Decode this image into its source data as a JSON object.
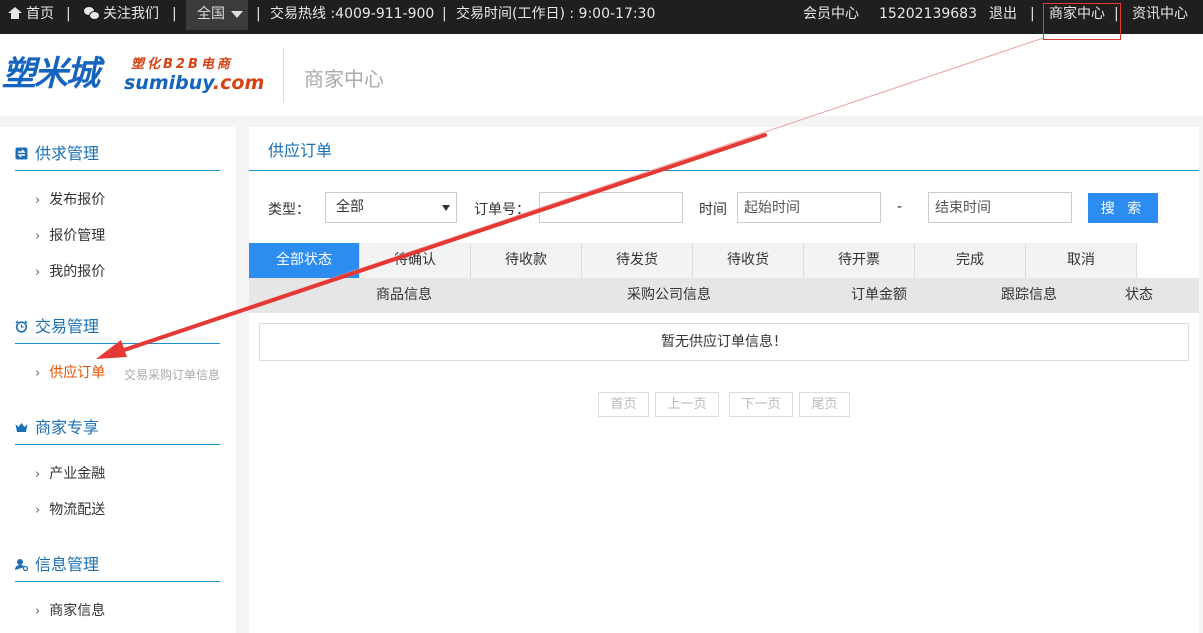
{
  "topbar": {
    "home": "首页",
    "follow": "关注我们",
    "region": "全国",
    "hotline": "交易热线 :4009-911-900",
    "hours": "交易时间(工作日) : 9:00-17:30",
    "member_center": "会员中心",
    "phone": "15202139683",
    "logout": "退出",
    "merchant_center": "商家中心",
    "news_center": "资讯中心",
    "divider": "|"
  },
  "header": {
    "logo_cn": "塑米城",
    "logo_tagline": "塑化B2B电商",
    "logo_en": "sumibuy",
    "logo_en_suffix": ".com",
    "title": "商家中心"
  },
  "sidebar": {
    "sections": [
      {
        "title": "供求管理",
        "icon": "swap-icon",
        "items": [
          "发布报价",
          "报价管理",
          "我的报价"
        ]
      },
      {
        "title": "交易管理",
        "icon": "alarm-icon",
        "items": [
          "供应订单"
        ]
      },
      {
        "title": "商家专享",
        "icon": "crown-icon",
        "items": [
          "产业金融",
          "物流配送"
        ]
      },
      {
        "title": "信息管理",
        "icon": "user-settings-icon",
        "items": [
          "商家信息"
        ]
      }
    ],
    "active_hint": "交易采购订单信息",
    "arrow_glyph": "›"
  },
  "main": {
    "title": "供应订单",
    "filters": {
      "type_label": "类型：",
      "type_value": "全部",
      "order_label": "订单号：",
      "order_value": "",
      "time_label": "时间",
      "start_placeholder": "起始时间",
      "dash": "-",
      "end_placeholder": "结束时间",
      "search": "搜 索"
    },
    "tabs": [
      "全部状态",
      "待确认",
      "待收款",
      "待发货",
      "待收货",
      "待开票",
      "完成",
      "取消"
    ],
    "active_tab": 0,
    "columns": [
      "商品信息",
      "采购公司信息",
      "订单金额",
      "跟踪信息",
      "状态"
    ],
    "empty_message": "暂无供应订单信息！",
    "pagination": [
      "首页",
      "上一页",
      "下一页",
      "尾页"
    ]
  },
  "colors": {
    "accent": "#2d8cf0",
    "title_blue": "#1a6fb5",
    "active_orange": "#e65100",
    "annotation_red": "#e53935"
  }
}
